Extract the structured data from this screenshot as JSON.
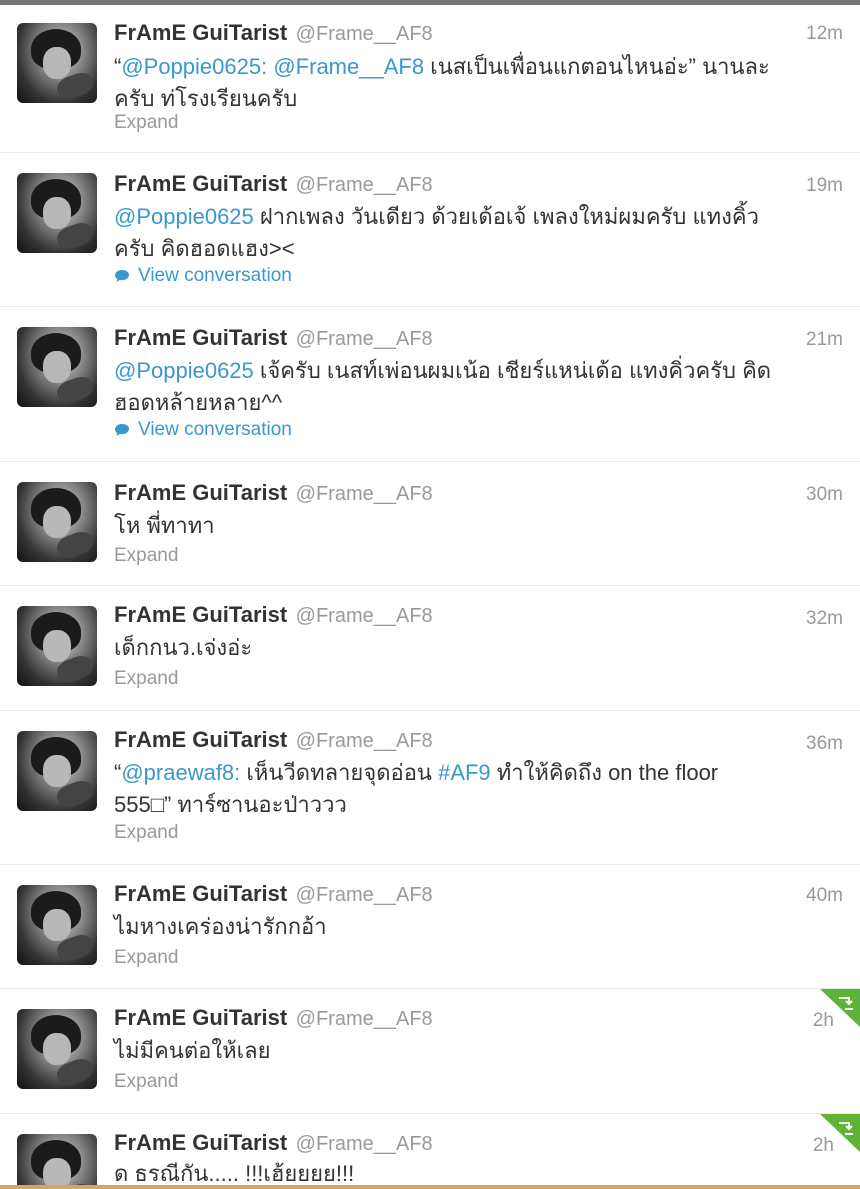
{
  "tweets": [
    {
      "name": "FrAmE GuiTarist",
      "handle": "@Frame__AF8",
      "time": "12m",
      "parts": [
        "“",
        "@Poppie0625:",
        " ",
        "@Frame__AF8",
        " เนสเป็นเพื่อนแกตอนไหนอ่ะ” นานละครับ ท่โรงเรียนครับ"
      ],
      "action": "Expand"
    },
    {
      "name": "FrAmE GuiTarist",
      "handle": "@Frame__AF8",
      "time": "19m",
      "parts": [
        "@Poppie0625",
        " ฝากเพลง วันเดียว ด้วยเด้อเจ้ เพลงใหม่ผมครับ แทงคิ้วครับ คิดฮอดแฮง><"
      ],
      "action": "View conversation"
    },
    {
      "name": "FrAmE GuiTarist",
      "handle": "@Frame__AF8",
      "time": "21m",
      "parts": [
        "@Poppie0625",
        " เจ้ครับ เนสท์เพ่อนผมเน้อ เชียร์แหน่เด้อ แทงคิ่วครับ คิดฮอดหล้ายหลาย^^"
      ],
      "action": "View conversation"
    },
    {
      "name": "FrAmE GuiTarist",
      "handle": "@Frame__AF8",
      "time": "30m",
      "parts": [
        "โห พี่ทาทา"
      ],
      "action": "Expand"
    },
    {
      "name": "FrAmE GuiTarist",
      "handle": "@Frame__AF8",
      "time": "32m",
      "parts": [
        "เด็กกนว.เจ่งอ่ะ"
      ],
      "action": "Expand"
    },
    {
      "name": "FrAmE GuiTarist",
      "handle": "@Frame__AF8",
      "time": "36m",
      "parts": [
        "“",
        "@praewaf8:",
        " เห็นวีดทลายจุดอ่อน ",
        "#AF9",
        " ทำให้คิดถึง on the floor 555□” ทาร์ซานอะป่าววว"
      ],
      "action": "Expand"
    },
    {
      "name": "FrAmE GuiTarist",
      "handle": "@Frame__AF8",
      "time": "40m",
      "parts": [
        "ไมหางเคร่องน่ารักกอ้า"
      ],
      "action": "Expand"
    },
    {
      "name": "FrAmE GuiTarist",
      "handle": "@Frame__AF8",
      "time": "2h",
      "parts": [
        "ไม่มีคนต่อให้เลย"
      ],
      "action": "Expand"
    },
    {
      "name": "FrAmE GuiTarist",
      "handle": "@Frame__AF8",
      "time": "2h",
      "parts": [
        "ด ธรณีกัน..... !!!เฮ้ยยยย!!!"
      ],
      "action": ""
    }
  ]
}
